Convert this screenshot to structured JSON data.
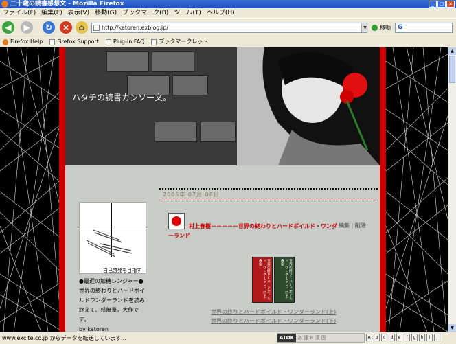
{
  "window": {
    "title": "二十歳の読書感想文 - Mozilla Firefox"
  },
  "menu": [
    "ファイル(F)",
    "編集(E)",
    "表示(V)",
    "移動(G)",
    "ブックマーク(B)",
    "ツール(T)",
    "ヘルプ(H)"
  ],
  "nav": {
    "url": "http://katoren.exblog.jp/",
    "go_label": "移動",
    "search_placeholder": "G"
  },
  "bookmarks": [
    "Firefox Help",
    "Firefox Support",
    "Plug-in FAQ",
    "ブックマークレット"
  ],
  "blog": {
    "title": "ハタチの読書カンソー文。",
    "avatar_caption": "自己啓発を目指す",
    "profile_text": "●最近の加糖レンジャー●世界の終わりとハードボイルドワンダーランドを読み終えて、感無量。大作です。",
    "profile_author": "by katoren",
    "post_date": "2005年 07月 08日",
    "post_title": "村上春樹－－－－－世界の終わりとハードボイルド・ワンダーランド",
    "post_meta": "編集 | 削除",
    "book1": "世界の終りとハードボイルド・ワンダーランド 村上春樹",
    "book2": "世界の終りとハードボイルド・ワンダーランド 村上春樹",
    "link1": "世界の終りとハードボイルド・ワンダーランド(上)",
    "link2": "世界の終りとハードボイルド・ワンダーランド(下)"
  },
  "status": {
    "text": "www.excite.co.jp からデータを転送しています...",
    "ime_label": "ATOK",
    "ime_modes": "あ 連 R 漢 固"
  },
  "colors": {
    "accent": "#cc0000",
    "titlebar": "#1d4fbf"
  }
}
